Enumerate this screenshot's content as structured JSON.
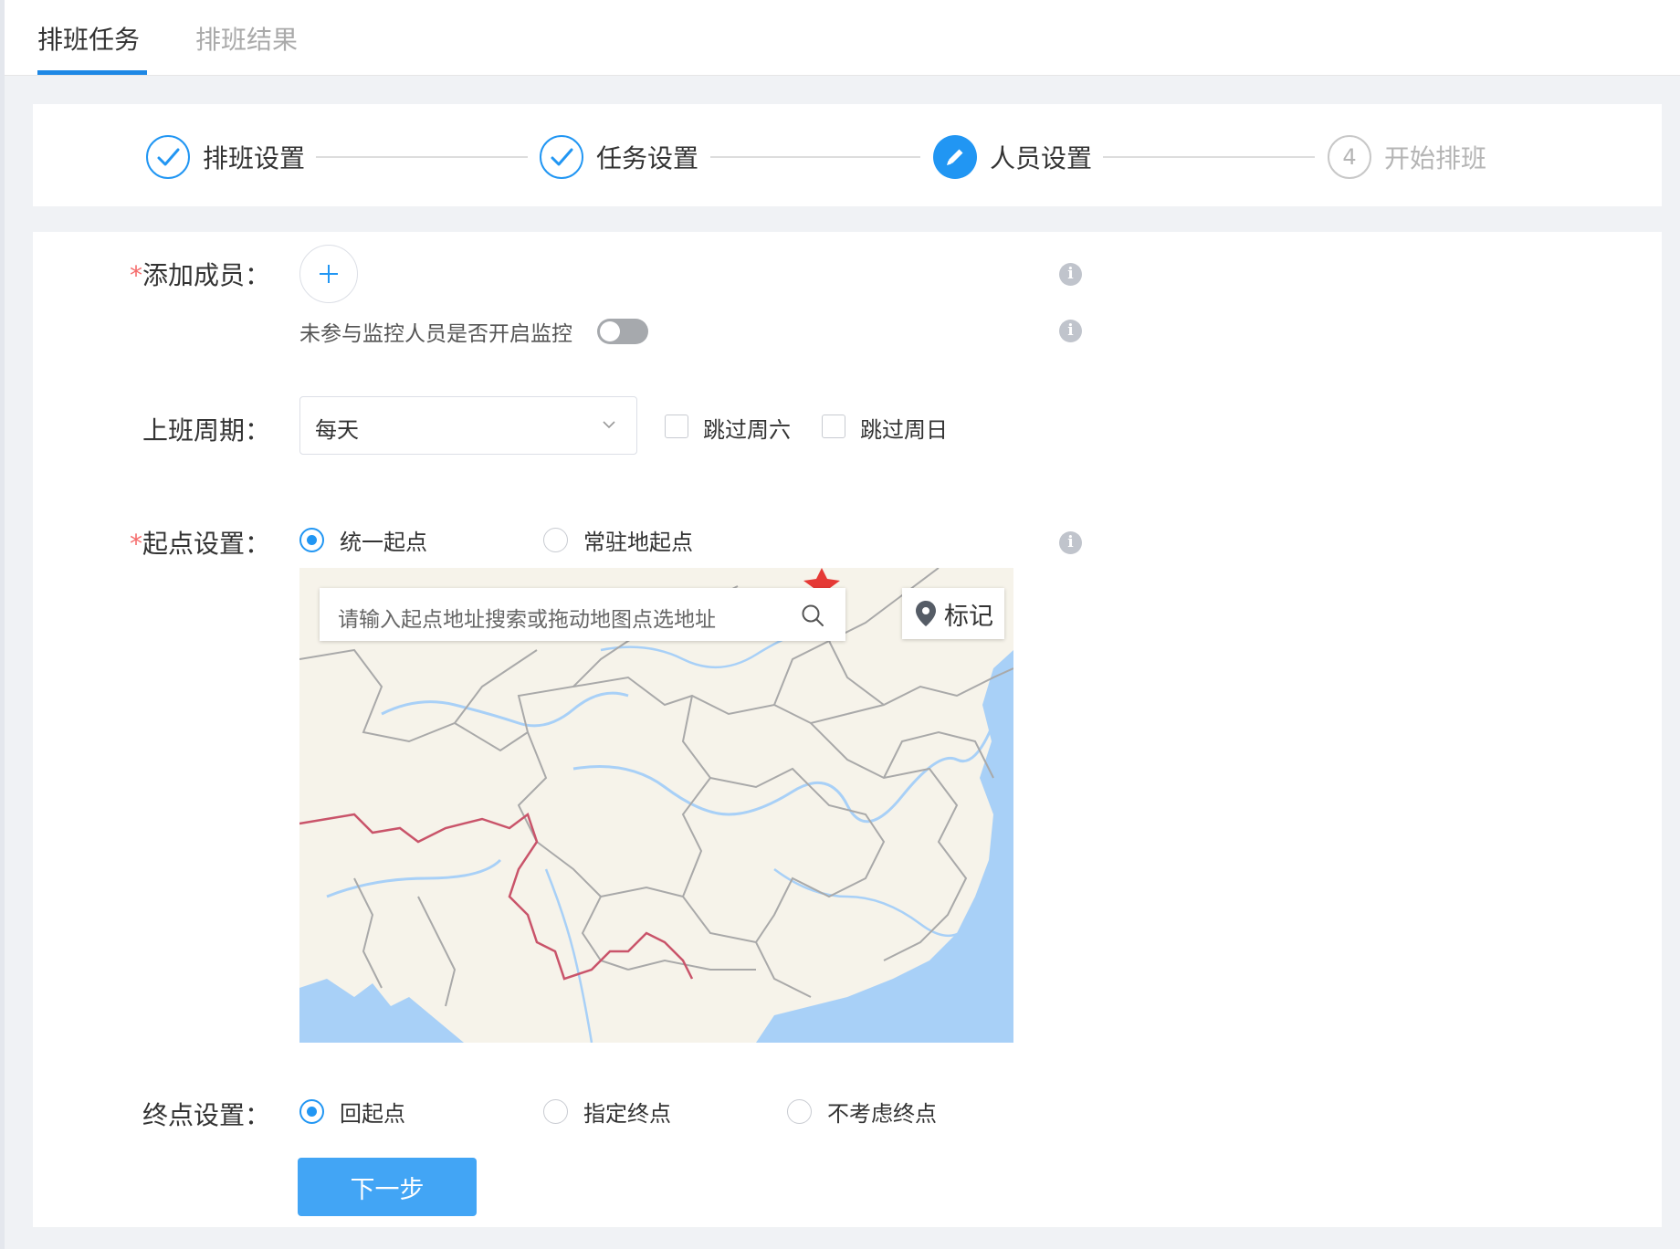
{
  "tabs": [
    {
      "label": "排班任务",
      "active": true
    },
    {
      "label": "排班结果",
      "active": false
    }
  ],
  "steps": [
    {
      "label": "排班设置",
      "status": "done"
    },
    {
      "label": "任务设置",
      "status": "done"
    },
    {
      "label": "人员设置",
      "status": "current"
    },
    {
      "label": "开始排班",
      "status": "todo",
      "number": "4"
    }
  ],
  "form": {
    "add_member": {
      "required_mark": "*",
      "label": "添加成员："
    },
    "monitor": {
      "text": "未参与监控人员是否开启监控",
      "enabled": false
    },
    "work_cycle": {
      "label": "上班周期：",
      "selected": "每天",
      "skip_saturday": {
        "label": "跳过周六",
        "checked": false
      },
      "skip_sunday": {
        "label": "跳过周日",
        "checked": false
      }
    },
    "start_point": {
      "required_mark": "*",
      "label": "起点设置：",
      "options": [
        {
          "label": "统一起点",
          "checked": true
        },
        {
          "label": "常驻地起点",
          "checked": false
        }
      ]
    },
    "map": {
      "search_placeholder": "请输入起点地址搜索或拖动地图点选地址",
      "mark_label": "标记"
    },
    "end_point": {
      "label": "终点设置：",
      "options": [
        {
          "label": "回起点",
          "checked": true
        },
        {
          "label": "指定终点",
          "checked": false
        },
        {
          "label": "不考虑终点",
          "checked": false
        }
      ]
    },
    "next_button": "下一步"
  },
  "icons": {
    "check": "check-icon",
    "edit": "pencil-icon",
    "info": "info-icon",
    "add": "plus-icon",
    "search": "search-icon",
    "location": "location-pin-icon",
    "dropdown": "chevron-down-icon"
  },
  "colors": {
    "primary": "#2196f3",
    "required": "#f56c6c",
    "button": "#42a5f5",
    "map_water": "#a8d0f7",
    "map_land": "#f6f3ea",
    "map_border": "#c9546a"
  }
}
